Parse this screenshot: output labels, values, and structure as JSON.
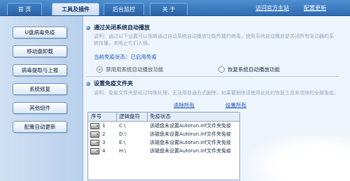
{
  "tabs": [
    {
      "label": "首 页"
    },
    {
      "label": "工具及插件"
    },
    {
      "label": "后台监控"
    },
    {
      "label": "关 于"
    }
  ],
  "top_links": {
    "official_site": "访问官方主站",
    "update": "配置更新"
  },
  "sidebar": {
    "items": [
      {
        "label": "U盘病毒免疫"
      },
      {
        "label": "移动盘卸载"
      },
      {
        "label": "病毒提取与上报"
      },
      {
        "label": "系统修复"
      },
      {
        "label": "其他组件"
      },
      {
        "label": "配置自动更新"
      }
    ]
  },
  "autorun_section": {
    "title": "通过关闭系统自动播放",
    "description": "说明：通过以下设置可以阻断通过自动系统自动播放功能传播的病毒，使用系统自动播放是关闭所有驱动器的系统传播，来阻止它们入侵。",
    "status": "当前免疫状态：已启用免疫",
    "option_disable": "禁用用系统自动播放功能",
    "option_restore": "恢复系统自动播放功能"
  },
  "immune_folder_section": {
    "title": "设置免疫文件夹",
    "description": "说明：免疫文件夹是经过特殊处理，无法用普通方式删除，如果要删除请使用此处的恢复工具来清除的全部免疫。",
    "clear_all": "清除所有",
    "set_all": "设置所有"
  },
  "table": {
    "headers": [
      "序号",
      "逻辑盘符",
      "免疫状态"
    ],
    "rows": [
      {
        "index": "1",
        "drive": "C:\\",
        "status": "该磁盘未设置Autorun.inf文件夹免疫"
      },
      {
        "index": "2",
        "drive": "D:\\",
        "status": "该磁盘未设置Autorun.inf文件夹免疫"
      },
      {
        "index": "3",
        "drive": "E:\\",
        "status": "该磁盘未设置Autorun.inf文件夹免疫"
      },
      {
        "index": "4",
        "drive": "H:\\",
        "status": "该磁盘未设置Autorun.inf文件夹免疫"
      }
    ]
  },
  "icons": {
    "bullet": "blue-bullet-icon",
    "drive": "hard-drive-icon"
  },
  "colors": {
    "topbar": "#2f6db3",
    "accent_link": "#1d55b8",
    "status_text": "#1b5fc4"
  }
}
